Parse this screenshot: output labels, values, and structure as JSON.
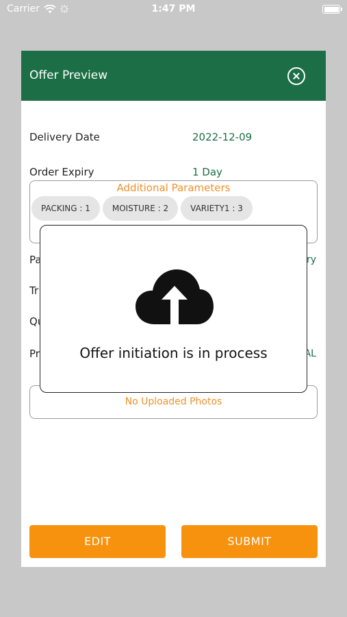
{
  "status_bar": {
    "carrier": "Carrier",
    "time": "1:47 PM"
  },
  "dialog": {
    "title": "Offer Preview",
    "fields": {
      "delivery_date_label": "Delivery Date",
      "delivery_date_value": "2022-12-09",
      "order_expiry_label": "Order Expiry",
      "order_expiry_value": "1 Day"
    },
    "additional_parameters": {
      "title": "Additional Parameters",
      "chips": [
        "PACKING : 1",
        "MOISTURE : 2",
        "VARIETY1 : 3"
      ]
    },
    "partial_rows": {
      "row1_label": "Pa",
      "row1_value": "ry",
      "row2_label": "Tr",
      "row3_label": "Qu",
      "row4_label": "Pr",
      "row4_value": "AL"
    },
    "photos_text": "No Uploaded Photos",
    "buttons": {
      "edit": "EDIT",
      "submit": "SUBMIT"
    }
  },
  "modal": {
    "message": "Offer initiation is in process",
    "icon": "cloud-upload-icon"
  },
  "colors": {
    "header_green": "#1b6e45",
    "accent_orange": "#f7920f",
    "label_orange": "#f0902a"
  }
}
